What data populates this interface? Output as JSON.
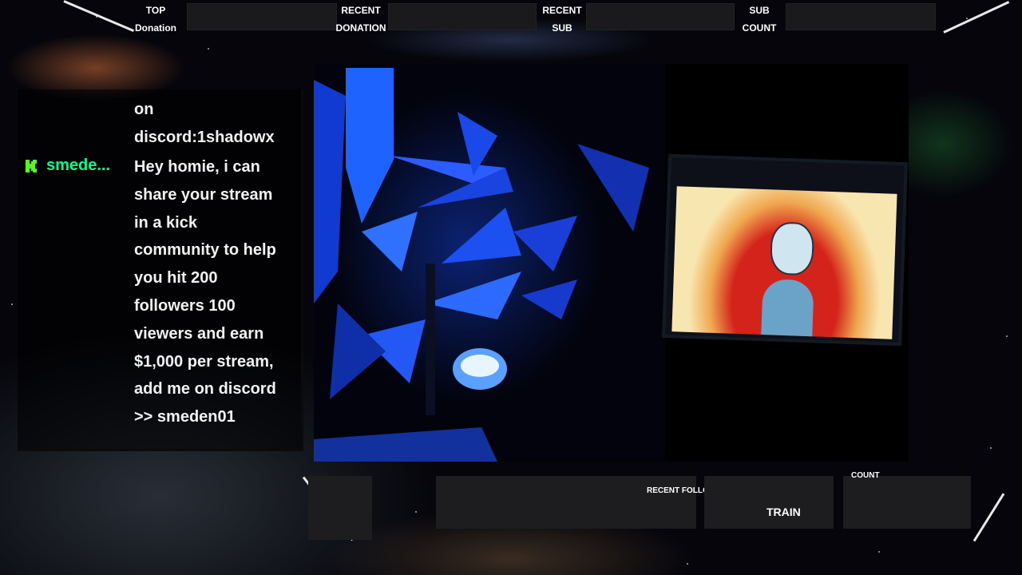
{
  "top_bar": {
    "top_donation": {
      "line1": "TOP",
      "line2": "Donation"
    },
    "recent_donation": {
      "line1": "RECENT",
      "line2": "DONATION"
    },
    "recent_sub": {
      "line1": "RECENT",
      "line2": "SUB"
    },
    "sub_count": {
      "line1": "SUB",
      "line2": "COUNT"
    }
  },
  "chat": {
    "prev_message_tail": [
      "on",
      "discord:1shadowx"
    ],
    "message": {
      "username": "smede...",
      "username_color": "#53fc18",
      "platform_icon": "kick-icon",
      "lines": [
        "Hey homie, i can",
        "share your stream",
        "in a kick",
        "community to help",
        "you hit 200",
        "followers 100",
        "viewers and earn",
        "$1,000 per stream,",
        "add me on discord",
        ">> smeden01"
      ]
    }
  },
  "bottom_bar": {
    "recent_follower_label": "RECENT FOLLOWER",
    "train_label": "TRAIN",
    "count_label": "COUNT"
  },
  "colors": {
    "panel": "#1a1a1c",
    "accent_line": "#e8e8e8",
    "video_blue": "#1e4cff",
    "screen_red": "#d4231a"
  }
}
